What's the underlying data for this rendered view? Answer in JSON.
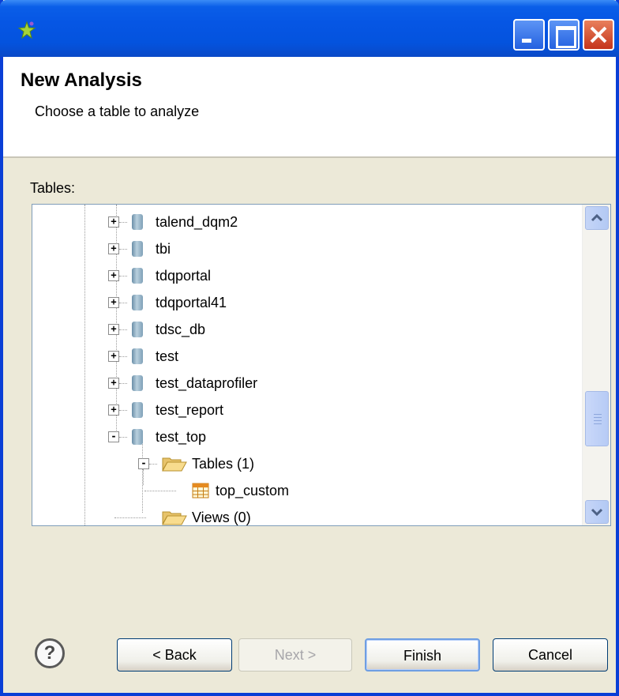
{
  "window": {
    "app_icon": "talend-star-icon",
    "controls": [
      "minimize",
      "maximize",
      "close"
    ]
  },
  "header": {
    "title": "New Analysis",
    "subtitle": "Choose a table to analyze"
  },
  "tables_label": "Tables:",
  "tree": {
    "items": [
      {
        "label": "talend_dqm2",
        "icon": "database-icon",
        "expander": "+"
      },
      {
        "label": "tbi",
        "icon": "database-icon",
        "expander": "+"
      },
      {
        "label": "tdqportal",
        "icon": "database-icon",
        "expander": "+"
      },
      {
        "label": "tdqportal41",
        "icon": "database-icon",
        "expander": "+"
      },
      {
        "label": "tdsc_db",
        "icon": "database-icon",
        "expander": "+"
      },
      {
        "label": "test",
        "icon": "database-icon",
        "expander": "+"
      },
      {
        "label": "test_dataprofiler",
        "icon": "database-icon",
        "expander": "+"
      },
      {
        "label": "test_report",
        "icon": "database-icon",
        "expander": "+"
      },
      {
        "label": "test_top",
        "icon": "database-icon",
        "expander": "-"
      },
      {
        "label": "Tables (1)",
        "icon": "folder-open-icon",
        "expander": "-"
      },
      {
        "label": "top_custom",
        "icon": "table-icon",
        "expander": ""
      },
      {
        "label": "Views (0)",
        "icon": "folder-open-icon",
        "expander": ""
      }
    ]
  },
  "footer": {
    "help": "?",
    "back_label": "< Back",
    "next_label": "Next >",
    "finish_label": "Finish",
    "cancel_label": "Cancel"
  }
}
